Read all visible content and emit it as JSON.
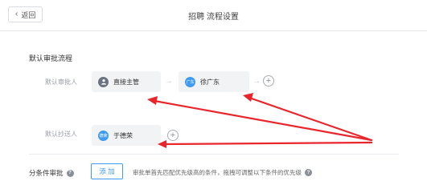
{
  "header": {
    "back_label": "返回",
    "title": "招聘 流程设置"
  },
  "main": {
    "section_title": "默认审批流程",
    "approver_row": {
      "label": "默认审批人",
      "nodes": [
        {
          "name": "直接主管",
          "avatar": "person-icon"
        },
        {
          "name": "徐广东",
          "avatar_text": "广东"
        }
      ]
    },
    "cc_row": {
      "label": "默认抄送人",
      "nodes": [
        {
          "name": "于德荣",
          "avatar_text": "德荣"
        }
      ]
    },
    "condition": {
      "label": "分条件审批",
      "add_label": "添 加",
      "description": "审批单首先匹配优先级高的条件，拖拽可调整以下条件的优先级"
    }
  },
  "colors": {
    "accent": "#3f9bf0",
    "annotation": "#e8262c"
  }
}
